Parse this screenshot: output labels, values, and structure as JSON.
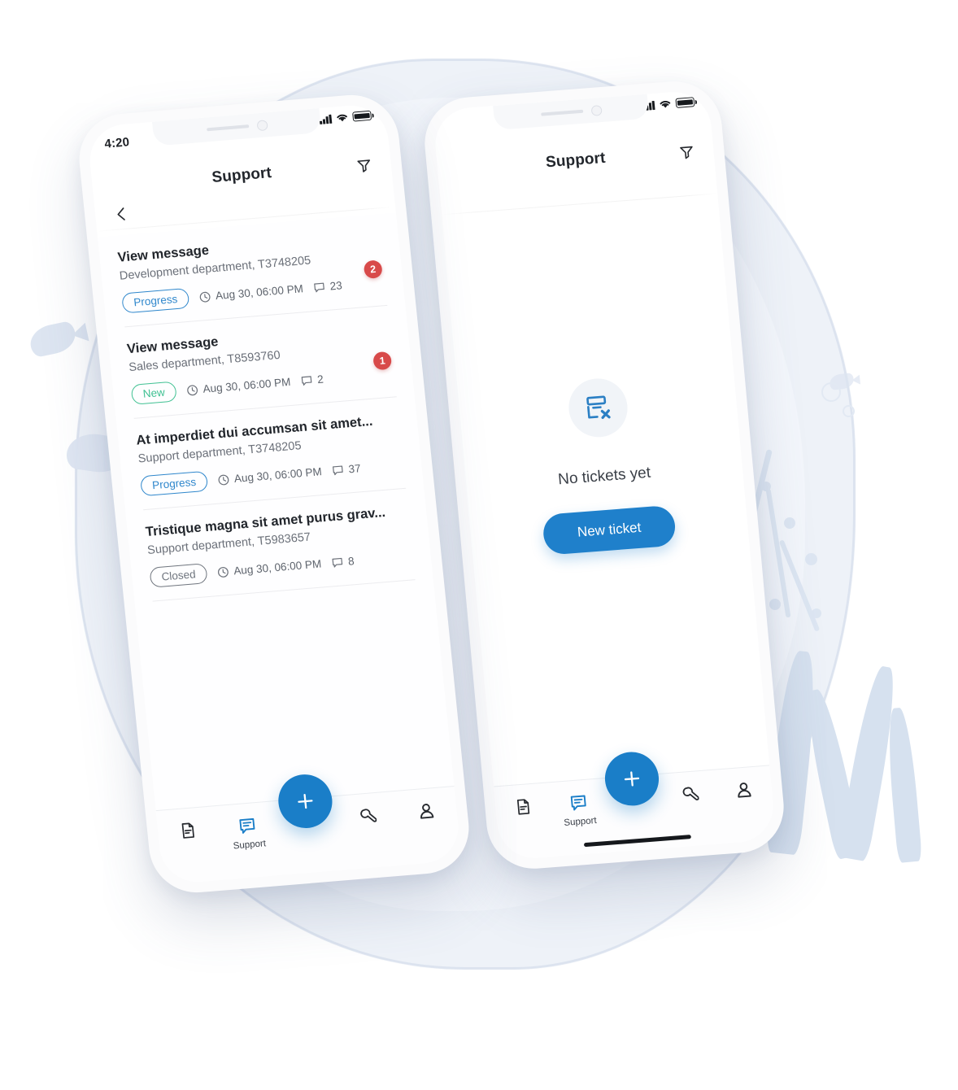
{
  "app": {
    "title": "Support",
    "status_bar": {
      "time": "4:20",
      "signal_icon": "cellular-signal-icon",
      "wifi_icon": "wifi-icon",
      "battery_icon": "battery-full-icon"
    },
    "header": {
      "back_icon": "chevron-left-icon",
      "filter_icon": "filter-funnel-icon"
    }
  },
  "colors": {
    "accent_blue": "#1a7ec8",
    "badge_progress": "#2f87cc",
    "badge_new": "#41c193",
    "badge_closed": "#6f757e",
    "notification_red": "#d84a4a",
    "backdrop": "#eef2f8",
    "decor": "#dde5f1"
  },
  "tickets": [
    {
      "title": "View message",
      "subtitle": "Development department, T3748205",
      "status": "Progress",
      "status_kind": "progress",
      "date": "Aug 30, 06:00 PM",
      "comments": "23",
      "unread": "2"
    },
    {
      "title": "View message",
      "subtitle": "Sales department, T8593760",
      "status": "New",
      "status_kind": "new",
      "date": "Aug 30, 06:00 PM",
      "comments": "2",
      "unread": "1"
    },
    {
      "title": "At imperdiet dui accumsan sit amet...",
      "subtitle": "Support department, T3748205",
      "status": "Progress",
      "status_kind": "progress",
      "date": "Aug 30, 06:00 PM",
      "comments": "37",
      "unread": ""
    },
    {
      "title": "Tristique magna sit amet purus grav...",
      "subtitle": "Support department, T5983657",
      "status": "Closed",
      "status_kind": "closed",
      "date": "Aug 30, 06:00 PM",
      "comments": "8",
      "unread": ""
    }
  ],
  "empty_state": {
    "icon": "no-tickets-icon",
    "message": "No tickets yet",
    "button_label": "New ticket"
  },
  "bottom_nav": {
    "fab_label": "+",
    "fab_icon": "plus-icon",
    "items": [
      {
        "icon": "document-icon",
        "label": "",
        "active": false
      },
      {
        "icon": "chat-message-icon",
        "label": "Support",
        "active": true
      },
      {
        "icon": "wrench-icon",
        "label": "",
        "active": false
      },
      {
        "icon": "person-icon",
        "label": "",
        "active": false
      }
    ]
  }
}
